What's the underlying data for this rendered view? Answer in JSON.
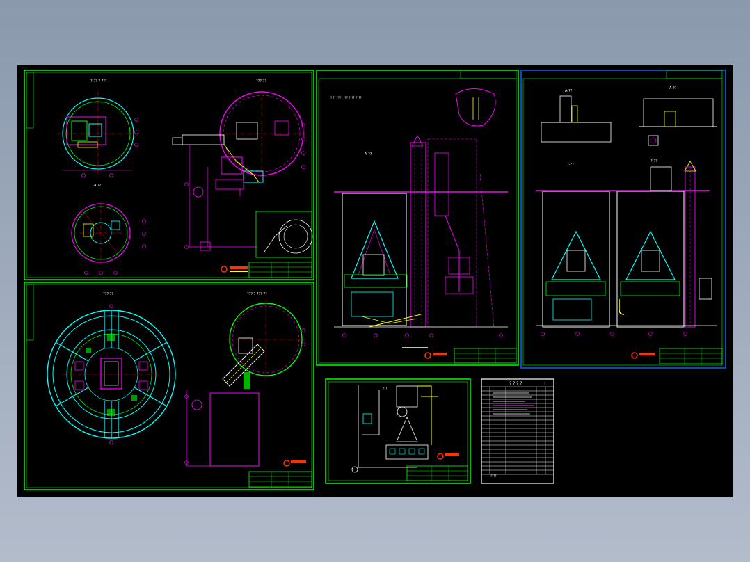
{
  "viewer": {
    "background_top": "#8a99ad",
    "background_bottom": "#b3bccb",
    "canvas_color": "#000000"
  },
  "colors": {
    "frame": "#00ff00",
    "structure": "#ff00ff",
    "equipment": "#00ffff",
    "dimension": "#ff0000",
    "text": "#ffffff",
    "accent": "#ffff00",
    "logo": "#ff3300"
  },
  "sheets": {
    "top_left": {
      "view_a_title": "?-?? ? ???",
      "view_b_title": "??? ??",
      "view_c_title": "A ??"
    },
    "bottom_left": {
      "view_a_title": "??? ??",
      "view_b_title": "??? ? ??? ??"
    },
    "section_center": {
      "view_title": "A-??",
      "note": "? ?? ???? ??? ???? ????"
    },
    "section_right": {
      "view_a_title": "A-??",
      "view_b_title": "A-??",
      "view_c_title": "?-??",
      "view_d_title": "?-??"
    },
    "flow_diagram": {
      "title": "???"
    },
    "drawing_list": {
      "header": "? ? ? ?",
      "rows_count_label": "?",
      "footer": "????"
    }
  }
}
